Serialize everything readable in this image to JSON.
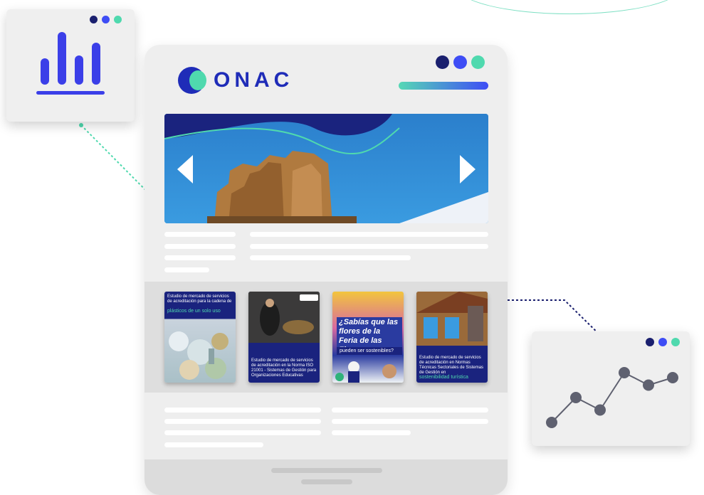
{
  "brand": {
    "name": "ONAC",
    "primary": "#1f2cb8",
    "accent": "#4fd9ae",
    "blue": "#3e4df5"
  },
  "window_dots": [
    "#1a1f6e",
    "#3e4df5",
    "#4fd9ae"
  ],
  "hero": {
    "prev_icon": "chevron-left-icon",
    "next_icon": "chevron-right-icon"
  },
  "gallery": {
    "cards": [
      {
        "headline": "Estudio de mercado de servicios de acreditación para la cadena de",
        "emphasis": "plásticos de un solo uso"
      },
      {
        "headline": "Estudio de mercado de servicios de acreditación en la Norma ISO 21001 - Sistemas de Gestión para Organizaciones Educativas",
        "emphasis": ""
      },
      {
        "headline": "¿Sabías que las flores de la Feria de las Flores",
        "emphasis": "pueden ser sostenibles?"
      },
      {
        "headline": "Estudio de mercado de servicios de acreditación en Normas Técnicas Sectoriales de Sistemas de Gestión en",
        "emphasis": "sostenibilidad turística"
      }
    ]
  },
  "bar_chart_window": {
    "icon": "bar-chart-icon",
    "bars": [
      0.5,
      1.0,
      0.55,
      0.8
    ]
  },
  "line_chart_window": {
    "icon": "line-chart-icon",
    "points": [
      1,
      3,
      2,
      5,
      4,
      4.6
    ]
  }
}
